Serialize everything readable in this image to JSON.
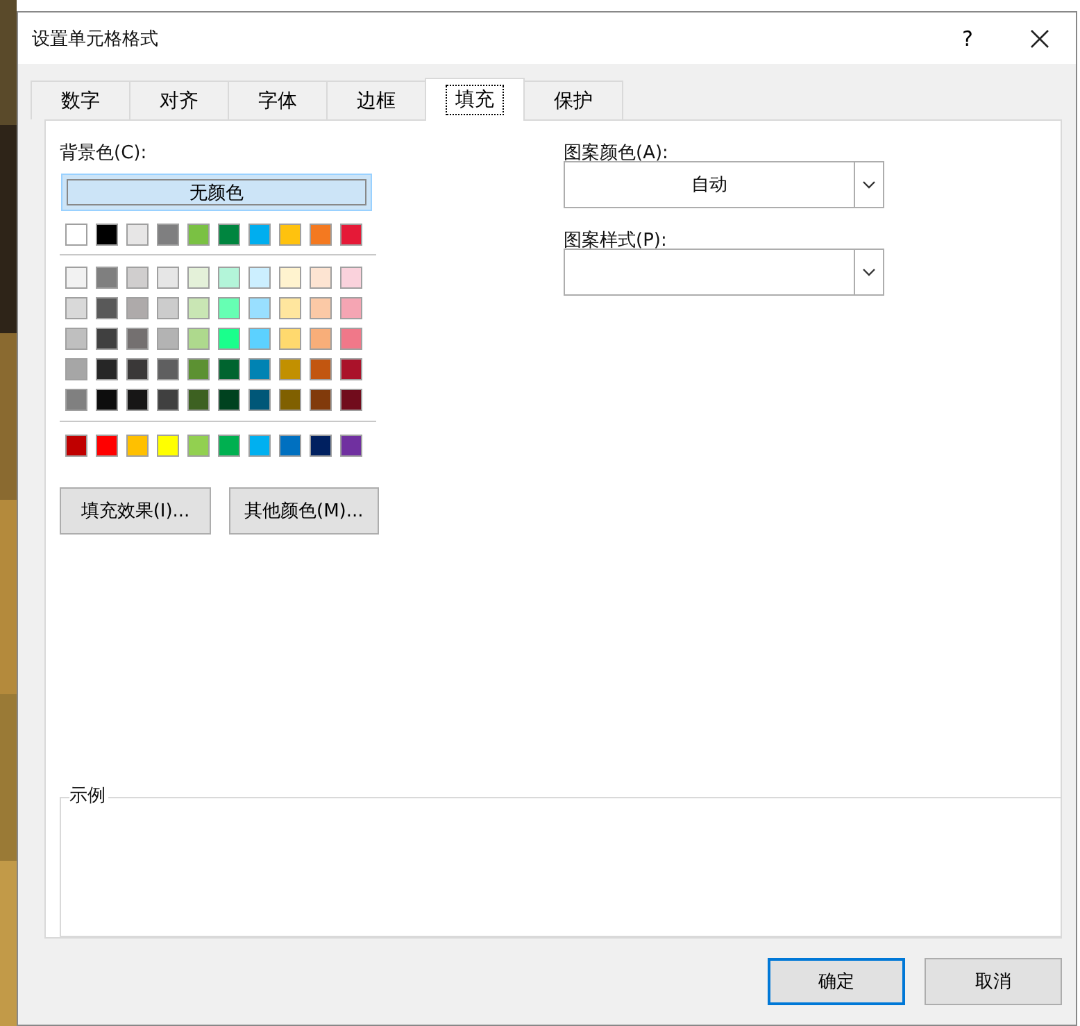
{
  "window": {
    "title": "设置单元格格式",
    "help": "?"
  },
  "tabs": [
    {
      "label": "数字",
      "selected": false
    },
    {
      "label": "对齐",
      "selected": false
    },
    {
      "label": "字体",
      "selected": false
    },
    {
      "label": "边框",
      "selected": false
    },
    {
      "label": "填充",
      "selected": true
    },
    {
      "label": "保护",
      "selected": false
    }
  ],
  "background_color": {
    "label": "背景色(C):",
    "no_color_button": "无颜色",
    "theme_row": [
      {
        "color": "#ffffff"
      },
      {
        "color": "#000000"
      },
      {
        "color": "#e7e6e6"
      },
      {
        "color": "#7f7f80"
      },
      {
        "color": "#7ac143"
      },
      {
        "color": "#00853f"
      },
      {
        "color": "#00aeef"
      },
      {
        "color": "#ffc20e"
      },
      {
        "color": "#f47920"
      },
      {
        "color": "#e51937"
      }
    ],
    "shade_rows": [
      [
        {
          "color": "#f2f2f2"
        },
        {
          "color": "#7f7f7f"
        },
        {
          "color": "#d0cece"
        },
        {
          "color": "#e6e6e6"
        },
        {
          "color": "#e4f1d9"
        },
        {
          "color": "#b3f5d9"
        },
        {
          "color": "#ccefff"
        },
        {
          "color": "#fff3cf"
        },
        {
          "color": "#fde4d2"
        },
        {
          "color": "#fad2dc"
        }
      ],
      [
        {
          "color": "#d9d9d9"
        },
        {
          "color": "#595959"
        },
        {
          "color": "#aeaaaa"
        },
        {
          "color": "#cccccc"
        },
        {
          "color": "#c9e6b4"
        },
        {
          "color": "#66ffb3"
        },
        {
          "color": "#99dfff"
        },
        {
          "color": "#ffe69e"
        },
        {
          "color": "#fbc9a6"
        },
        {
          "color": "#f5a5b3"
        }
      ],
      [
        {
          "color": "#bfbfbf"
        },
        {
          "color": "#404040"
        },
        {
          "color": "#747070"
        },
        {
          "color": "#b3b3b3"
        },
        {
          "color": "#aed98d"
        },
        {
          "color": "#1aff8c"
        },
        {
          "color": "#5cd1ff"
        },
        {
          "color": "#ffd96e"
        },
        {
          "color": "#f8ae79"
        },
        {
          "color": "#f07889"
        }
      ],
      [
        {
          "color": "#a6a6a6"
        },
        {
          "color": "#262626"
        },
        {
          "color": "#3a3838"
        },
        {
          "color": "#5f5f60"
        },
        {
          "color": "#5c9132"
        },
        {
          "color": "#00642f"
        },
        {
          "color": "#0083b3"
        },
        {
          "color": "#c29000"
        },
        {
          "color": "#c25610"
        },
        {
          "color": "#aa122a"
        }
      ],
      [
        {
          "color": "#808080"
        },
        {
          "color": "#0d0d0d"
        },
        {
          "color": "#171616"
        },
        {
          "color": "#404040"
        },
        {
          "color": "#3d6121"
        },
        {
          "color": "#00421f"
        },
        {
          "color": "#005778"
        },
        {
          "color": "#806000"
        },
        {
          "color": "#813a0b"
        },
        {
          "color": "#710c1c"
        }
      ]
    ],
    "standard_row": [
      {
        "color": "#c00000"
      },
      {
        "color": "#ff0000"
      },
      {
        "color": "#ffc000"
      },
      {
        "color": "#ffff00"
      },
      {
        "color": "#92d050"
      },
      {
        "color": "#00b050"
      },
      {
        "color": "#00b0f0"
      },
      {
        "color": "#0070c0"
      },
      {
        "color": "#002060"
      },
      {
        "color": "#7030a0"
      }
    ]
  },
  "buttons": [
    "填充效果(I)...",
    "其他颜色(M)..."
  ],
  "pattern_color": {
    "label": "图案颜色(A):",
    "value": "自动"
  },
  "pattern_style": {
    "label": "图案样式(P):"
  },
  "sample": {
    "label": "示例"
  },
  "footer": {
    "ok": "确定",
    "cancel": "取消"
  }
}
